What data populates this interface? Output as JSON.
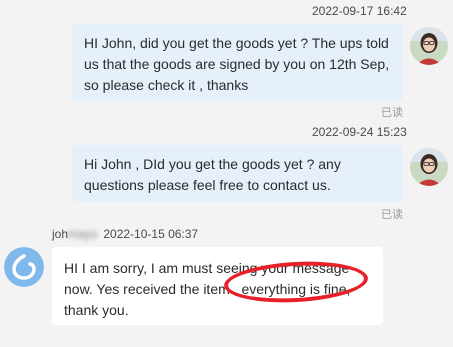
{
  "messages": [
    {
      "timestamp": "2022-09-17 16:42",
      "text": "HI John, did you get the goods yet ? The ups told us that the goods are signed by you on 12th Sep, so please check it , thanks",
      "read_status": "已读"
    },
    {
      "timestamp": "2022-09-24 15:23",
      "text": "Hi John , DId you get the goods yet ? any questions please feel free to contact us.",
      "read_status": "已读"
    }
  ],
  "incoming": {
    "sender_name_prefix": "joh",
    "sender_name_blurred": "mayo",
    "timestamp": "2022-10-15 06:37",
    "text": "HI I am sorry, I am must seeing your message now. Yes received the item , everything is fine, thank you."
  },
  "colors": {
    "outgoing_bubble": "#e6f0fb",
    "incoming_bubble": "#ffffff",
    "highlight": "#e8202a",
    "agent_avatar": "#7fb8ea"
  },
  "icons": {
    "user_avatar": "user-photo-avatar",
    "contact_avatar": "drop-logo-avatar",
    "annotation": "red-ellipse-highlight"
  }
}
